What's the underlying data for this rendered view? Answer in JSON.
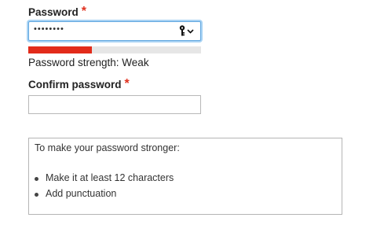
{
  "password": {
    "label": "Password",
    "required_marker": "*",
    "masked_value": "••••••••",
    "key_icon": "key-dropdown-icon",
    "focused": true
  },
  "strength": {
    "text": "Password strength: Weak",
    "level": 0.37,
    "color": "#e22b1a"
  },
  "confirm": {
    "label": "Confirm password",
    "required_marker": "*",
    "value": ""
  },
  "help": {
    "intro": "To make your password stronger:",
    "tips": [
      "Make it at least 12 characters",
      "Add punctuation"
    ]
  }
}
